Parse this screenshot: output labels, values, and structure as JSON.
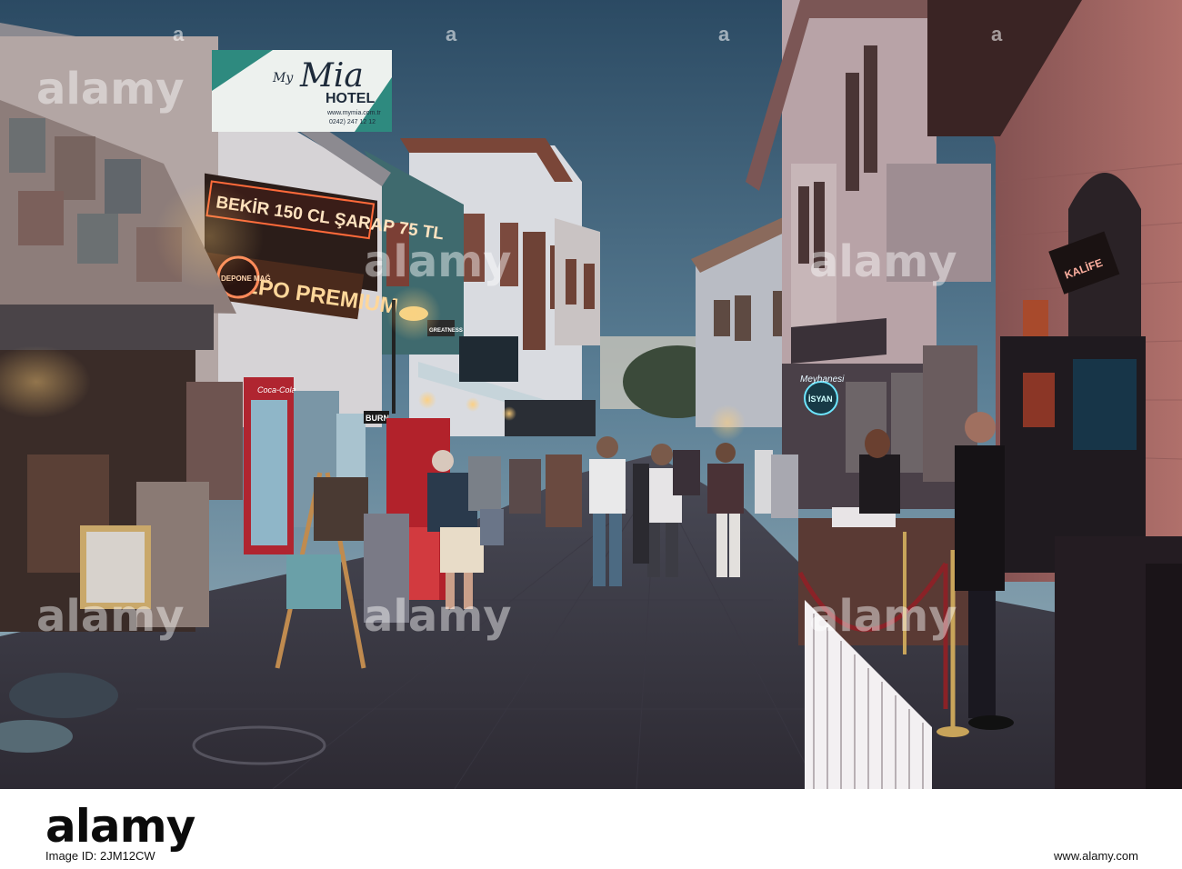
{
  "photo": {
    "signs": {
      "hotel_my": "My",
      "hotel_mia": "Mia",
      "hotel_word": "HOTEL",
      "hotel_url": "www.mymia.com.tr",
      "hotel_phone": "0242) 247 12 12",
      "led_ticker": "BEKİR 150 CL ŞARAP 75 TL",
      "depo_neon": "DEPO PREMIUM",
      "round_neon": "DEPONE MAĞ",
      "greatness": "GREATNESS",
      "coca_cola": "Coca-Cola",
      "burn": "BURN",
      "isyan_neon": "İSYAN",
      "isyan_sub": "Meyhanesi",
      "bar_right_neon": "KALİFE"
    }
  },
  "watermarks": {
    "logo_text": "alamy",
    "small_text": "a"
  },
  "footer": {
    "logo": "alamy",
    "image_id": "Image ID: 2JM12CW",
    "url": "www.alamy.com"
  }
}
